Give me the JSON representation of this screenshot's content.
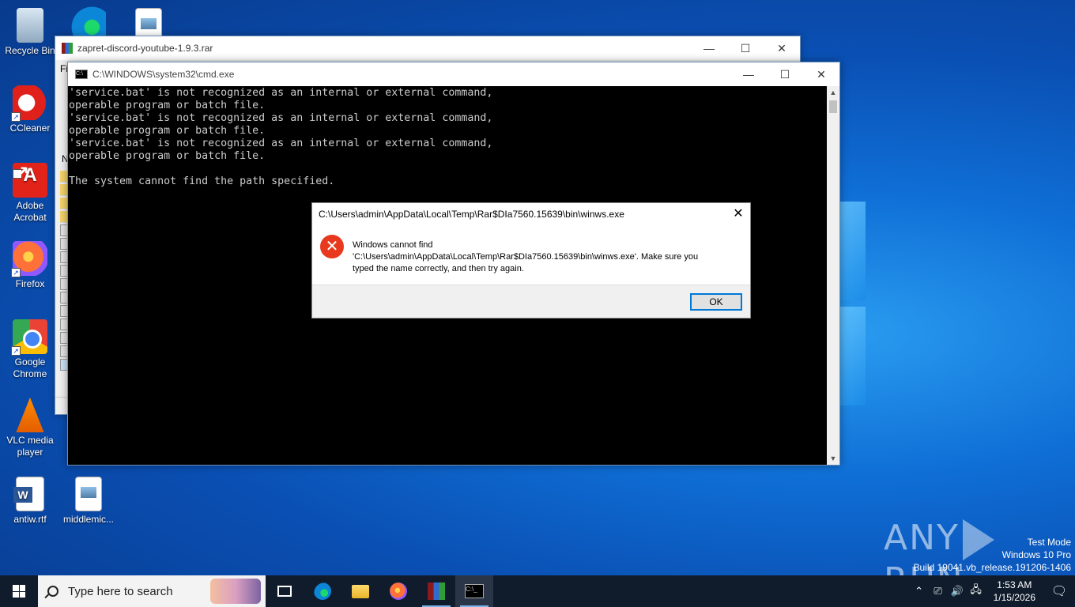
{
  "desktop": {
    "icons": [
      {
        "label": "Recycle Bin",
        "icon": "recycle-bin-icon"
      },
      {
        "label": "CCleaner",
        "icon": "ccleaner-icon"
      },
      {
        "label": "Adobe Acrobat",
        "icon": "acrobat-icon"
      },
      {
        "label": "Firefox",
        "icon": "firefox-icon"
      },
      {
        "label": "Google Chrome",
        "icon": "chrome-icon"
      },
      {
        "label": "VLC media player",
        "icon": "vlc-icon"
      },
      {
        "label": "antiw.rtf",
        "icon": "word-document-icon"
      },
      {
        "label": "middlemic...",
        "icon": "image-file-icon"
      }
    ]
  },
  "rar_window": {
    "title": "zapret-discord-youtube-1.9.3.rar",
    "menu_visible": "Fi",
    "column_visible": "N",
    "ctl_min": "—",
    "ctl_max": "☐",
    "ctl_close": "✕"
  },
  "cmd_window": {
    "title": "C:\\WINDOWS\\system32\\cmd.exe",
    "output": "'service.bat' is not recognized as an internal or external command,\noperable program or batch file.\n'service.bat' is not recognized as an internal or external command,\noperable program or batch file.\n'service.bat' is not recognized as an internal or external command,\noperable program or batch file.\n\nThe system cannot find the path specified.",
    "ctl_min": "—",
    "ctl_max": "☐",
    "ctl_close": "✕"
  },
  "error_dialog": {
    "title": "C:\\Users\\admin\\AppData\\Local\\Temp\\Rar$DIa7560.15639\\bin\\winws.exe",
    "message_line1": "Windows cannot find",
    "message_line2": "'C:\\Users\\admin\\AppData\\Local\\Temp\\Rar$DIa7560.15639\\bin\\winws.exe'. Make sure you",
    "message_line3": "typed the name correctly, and then try again.",
    "ok_label": "OK",
    "close_glyph": "✕",
    "icon_glyph": "✕",
    "icon_color": "#e8381e"
  },
  "watermark": {
    "text_left": "ANY",
    "text_right": "RUN"
  },
  "test_mode": {
    "line1": "Test Mode",
    "line2": "Windows 10 Pro",
    "line3": "Build 19041.vb_release.191206-1406"
  },
  "taskbar": {
    "search_placeholder": "Type here to search",
    "apps": [
      "task-view-icon",
      "edge-icon",
      "file-explorer-icon",
      "firefox-icon",
      "winrar-icon",
      "cmd-icon"
    ],
    "tray": {
      "chevron": "⌃",
      "time": "1:53 AM",
      "date": "1/15/2026"
    },
    "accent_color": "#101c2c"
  }
}
